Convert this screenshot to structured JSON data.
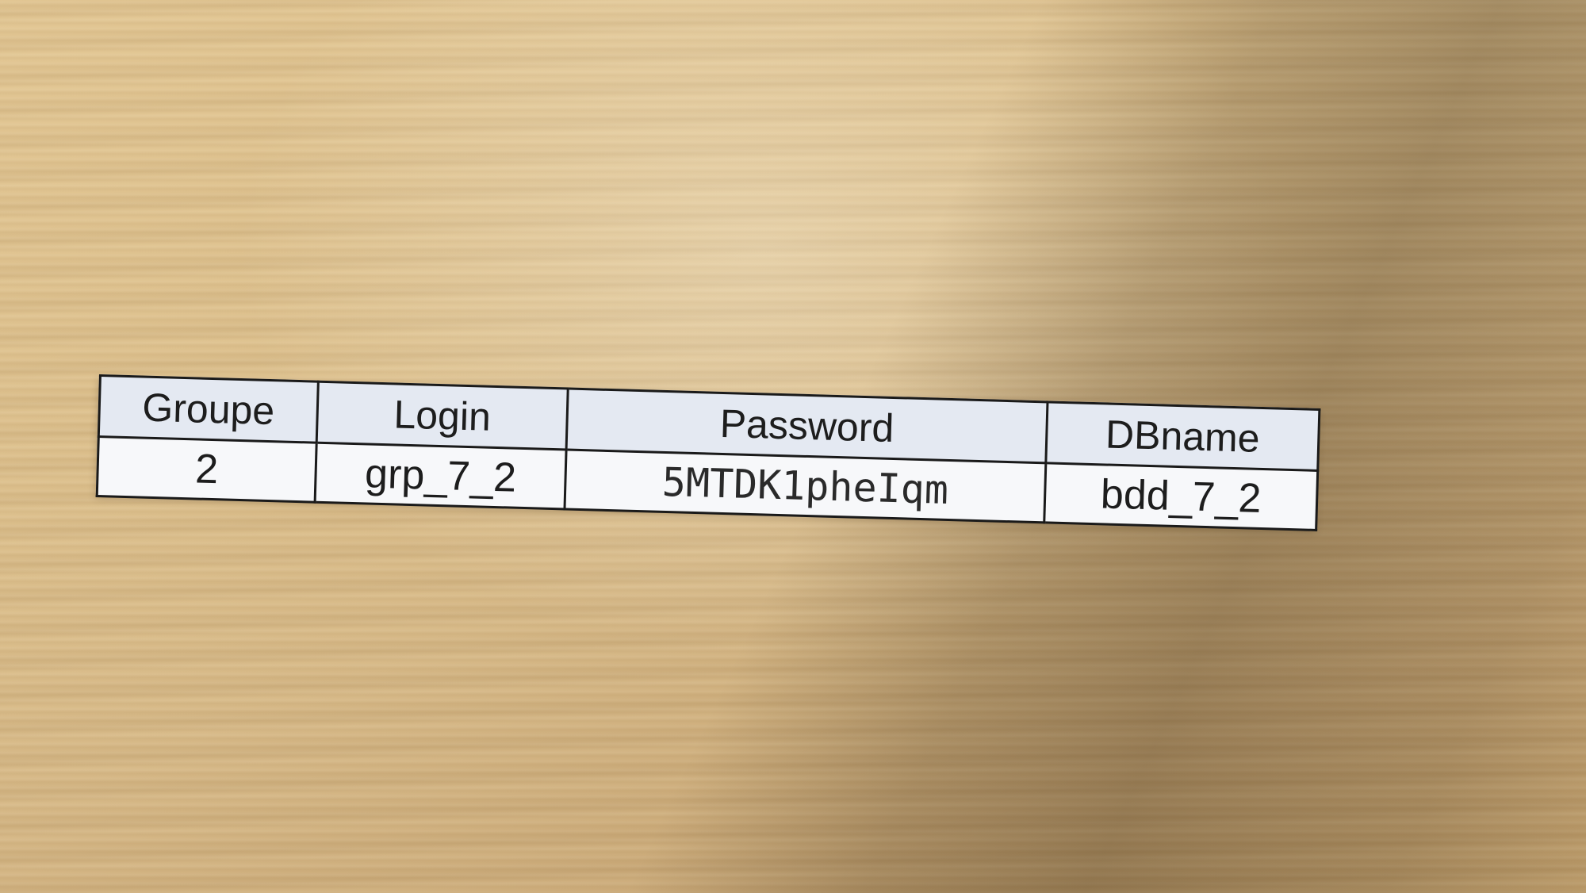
{
  "scene": {
    "surface": "wooden desk",
    "object": "printed paper strip with credentials table"
  },
  "table": {
    "headers": [
      "Groupe",
      "Login",
      "Password",
      "DBname"
    ],
    "row": [
      "2",
      "grp_7_2",
      "5MTDK1pheIqm",
      "bdd_7_2"
    ]
  },
  "colors": {
    "wood": "#d6b886",
    "header_bg": "#e4e9f2",
    "cell_bg": "#f7f8fa",
    "border": "#1a1a1a"
  }
}
